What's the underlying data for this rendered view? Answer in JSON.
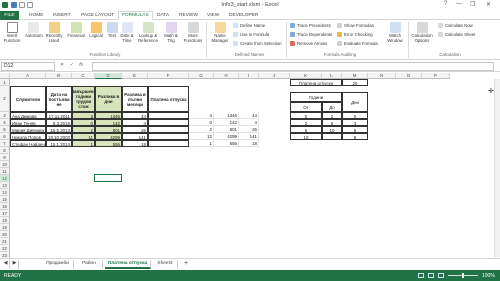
{
  "window": {
    "title": "Info3_start.xlsm - Excel",
    "help": "?",
    "minimize": "—",
    "restore": "❐",
    "close": "✕"
  },
  "tabs": [
    "FILE",
    "HOME",
    "INSERT",
    "PAGE LAYOUT",
    "FORMULAS",
    "DATA",
    "REVIEW",
    "VIEW",
    "DEVELOPER"
  ],
  "ribbon": {
    "insert_function": "Insert Function",
    "autosum": "AutoSum",
    "recently_used": "Recently Used",
    "financial": "Financial",
    "logical": "Logical",
    "text": "Text",
    "date_time": "Date & Time",
    "lookup": "Lookup & Reference",
    "math": "Math & Trig",
    "more": "More Functions",
    "group_library": "Function Library",
    "name_manager": "Name Manager",
    "define_name": "Define Name",
    "use_in_formula": "Use in Formula",
    "create_from_selection": "Create from Selection",
    "group_names": "Defined Names",
    "trace_precedents": "Trace Precedents",
    "trace_dependents": "Trace Dependents",
    "remove_arrows": "Remove Arrows",
    "show_formulas": "Show Formulas",
    "error_checking": "Error Checking",
    "evaluate_formula": "Evaluate Formula",
    "watch_window": "Watch Window",
    "group_auditing": "Formula Auditing",
    "calc_options": "Calculation Options",
    "calc_now": "Calculate Now",
    "calc_sheet": "Calculate Sheet",
    "group_calc": "Calculation"
  },
  "formula_bar": {
    "name_box": "D12",
    "fx": "fx",
    "cancel": "✕",
    "enter": "✓",
    "formula": ""
  },
  "columns": [
    "A",
    "B",
    "C",
    "D",
    "E",
    "F",
    "G",
    "H",
    "I",
    "J",
    "K",
    "L",
    "M",
    "N",
    "O",
    "P"
  ],
  "rows": [
    "1",
    "2",
    "3",
    "4",
    "5",
    "6",
    "7",
    "8",
    "9",
    "10",
    "11",
    "12",
    "13",
    "14",
    "15",
    "16",
    "17",
    "18",
    "19",
    "20",
    "21",
    "22",
    "23",
    "24",
    "25"
  ],
  "table": {
    "headers": [
      "Служители",
      "Дата на постъпва не",
      "Навършени години трудов стаж",
      "Разлика в дни",
      "Разлика в пълни месеци",
      "Платена отпуска"
    ],
    "rows": [
      [
        "Ана Димова",
        "17.11.2011",
        "3",
        "1346",
        "44",
        ""
      ],
      [
        "Иван Теняв",
        "5.3.2015",
        "0",
        "142",
        "4",
        ""
      ],
      [
        "Мария Диянова",
        "15.5.2013",
        "2",
        "801",
        "26",
        ""
      ],
      [
        "Николa Попов",
        "18.10.2003",
        "11",
        "4299",
        "141",
        ""
      ],
      [
        "Стефан Найденов",
        "15.1.2014",
        "1",
        "556",
        "18",
        ""
      ]
    ]
  },
  "side_values": [
    [
      "4",
      "1346",
      "44"
    ],
    [
      "0",
      "142",
      "4"
    ],
    [
      "2",
      "801",
      "26"
    ],
    [
      "12",
      "4299",
      "141"
    ],
    [
      "1",
      "556",
      "18"
    ]
  ],
  "lookup": {
    "label": "Платена отпуска",
    "value": "20",
    "years_header": "Години",
    "days_header": "Дни",
    "from": "От",
    "to": "До",
    "rows": [
      [
        "0",
        "2",
        "0"
      ],
      [
        "2",
        "5",
        "3"
      ],
      [
        "5",
        "10",
        "5"
      ],
      [
        "10",
        "",
        "8"
      ]
    ]
  },
  "sheets": [
    "Продажби",
    "Район",
    "Платена отпуска",
    "Sheet3"
  ],
  "add_sheet": "+",
  "status": {
    "ready": "READY",
    "zoom": "100%"
  }
}
